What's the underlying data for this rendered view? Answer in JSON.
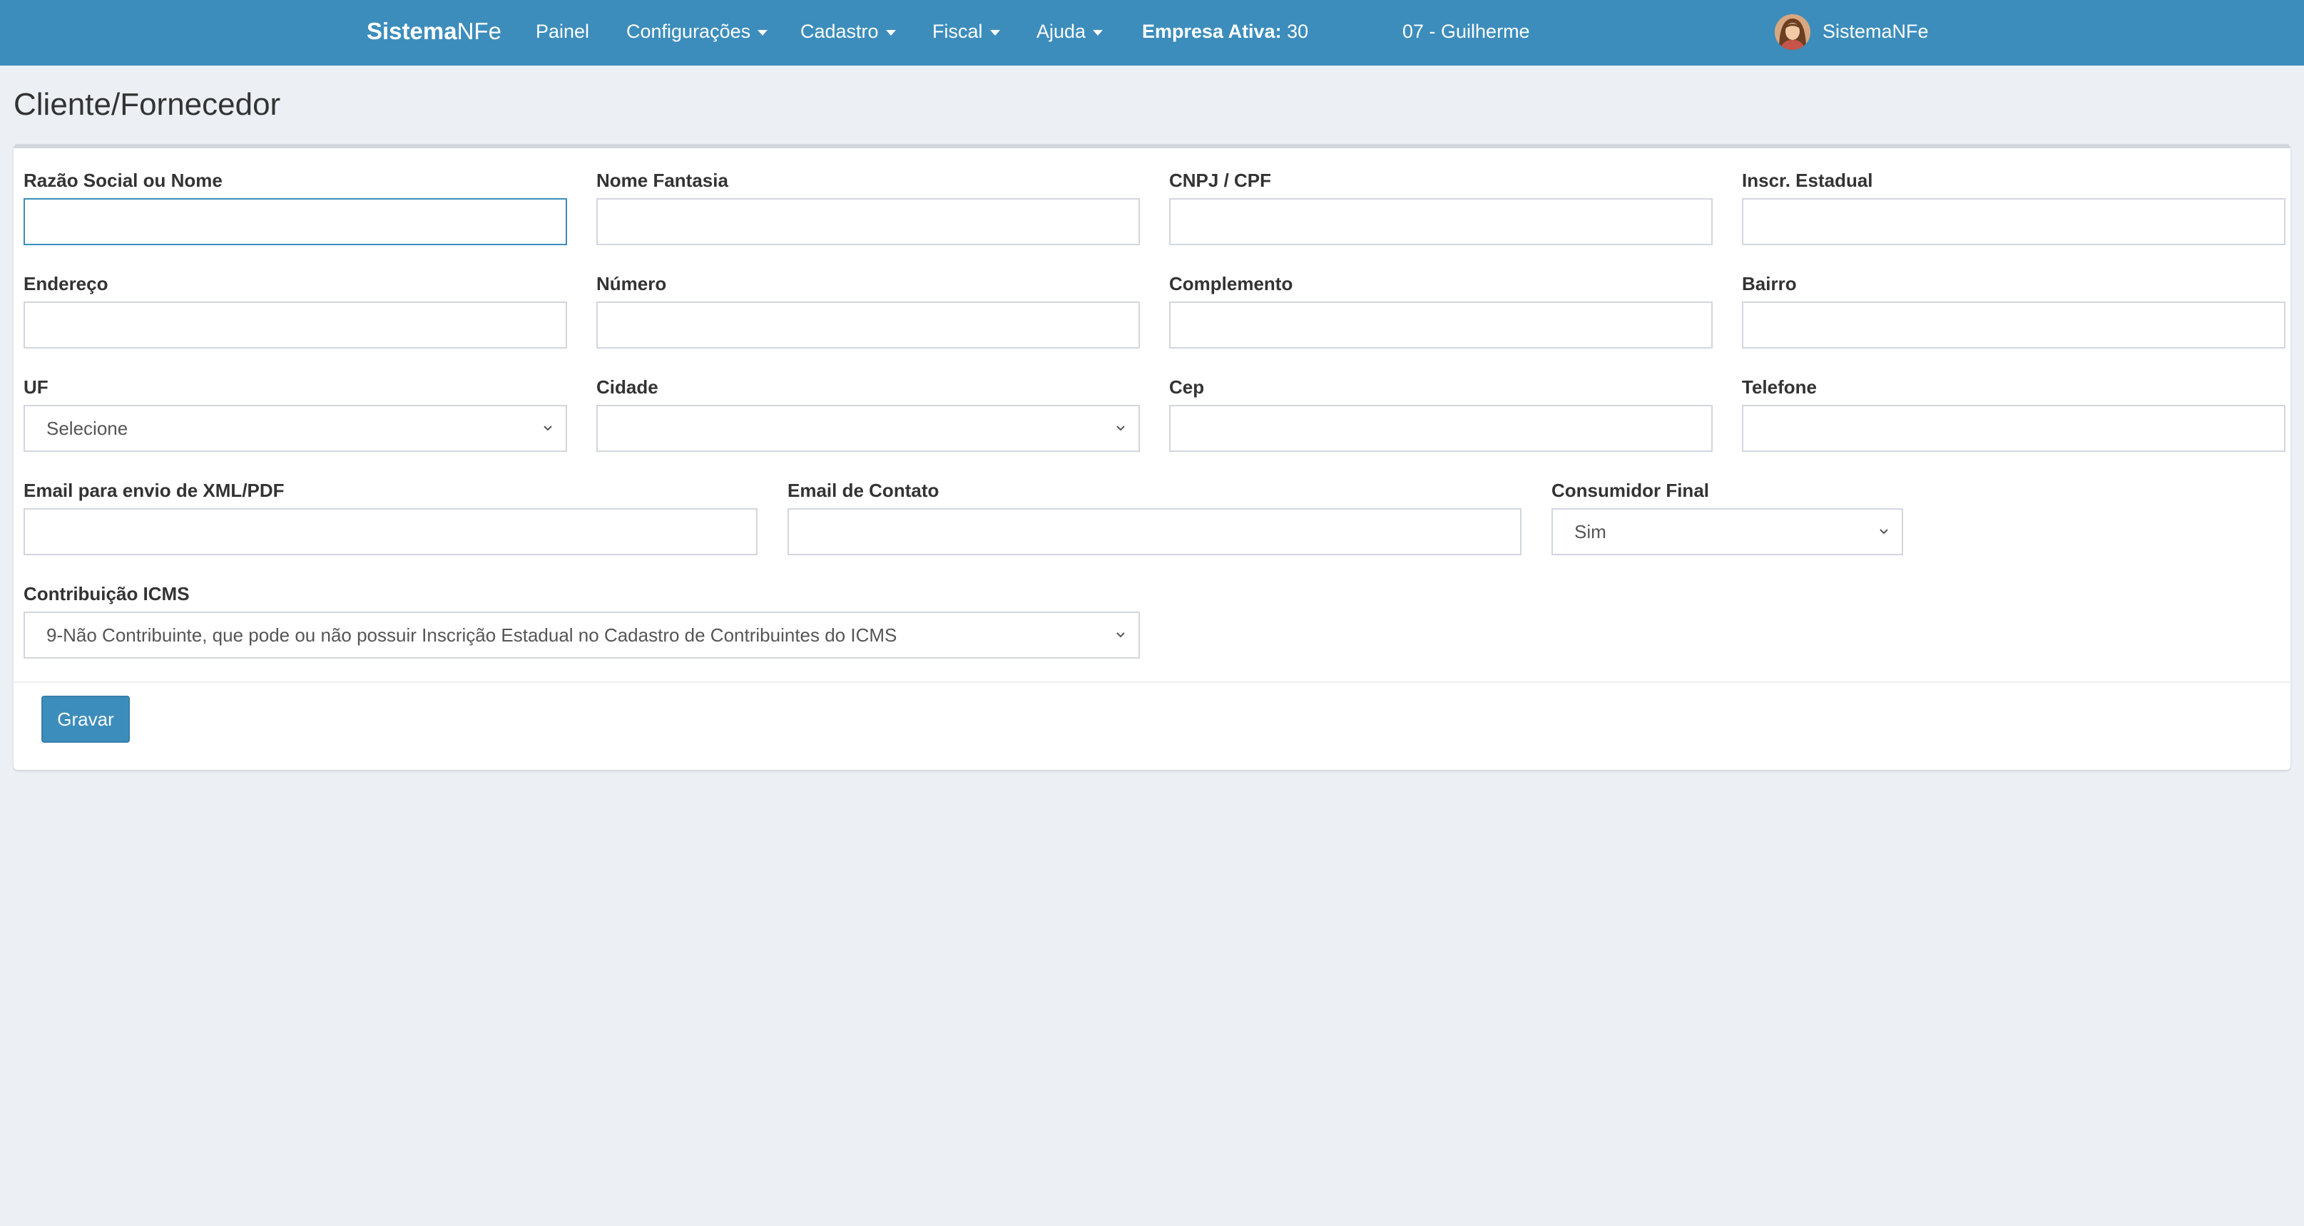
{
  "navbar": {
    "brand_bold": "Sistema",
    "brand_rest": "NFe",
    "items": [
      "Painel",
      "Configurações",
      "Cadastro",
      "Fiscal",
      "Ajuda"
    ],
    "empresa_label": "Empresa Ativa:",
    "empresa_number": "30",
    "empresa_name": "07 - Guilherme",
    "user_name": "SistemaNFe"
  },
  "page": {
    "title": "Cliente/Fornecedor"
  },
  "form": {
    "razao_social": {
      "label": "Razão Social ou Nome",
      "value": ""
    },
    "nome_fantasia": {
      "label": "Nome Fantasia",
      "value": ""
    },
    "cnpj_cpf": {
      "label": "CNPJ / CPF",
      "value": ""
    },
    "inscr_estadual": {
      "label": "Inscr. Estadual",
      "value": ""
    },
    "endereco": {
      "label": "Endereço",
      "value": ""
    },
    "numero": {
      "label": "Número",
      "value": ""
    },
    "complemento": {
      "label": "Complemento",
      "value": ""
    },
    "bairro": {
      "label": "Bairro",
      "value": ""
    },
    "uf": {
      "label": "UF",
      "selected": "Selecione"
    },
    "cidade": {
      "label": "Cidade",
      "selected": ""
    },
    "cep": {
      "label": "Cep",
      "value": ""
    },
    "telefone": {
      "label": "Telefone",
      "value": ""
    },
    "email_xml": {
      "label": "Email para envio de XML/PDF",
      "value": ""
    },
    "email_contato": {
      "label": "Email de Contato",
      "value": ""
    },
    "consumidor_final": {
      "label": "Consumidor Final",
      "selected": "Sim"
    },
    "contribuicao_icms": {
      "label": "Contribuição ICMS",
      "selected": "9-Não Contribuinte, que pode ou não possuir Inscrição Estadual no Cadastro de Contribuintes do ICMS"
    },
    "save_label": "Gravar"
  },
  "colors": {
    "navbar": "#3c8dbc",
    "background": "#ecf0f5",
    "button": "#3c8dbc",
    "box_border": "#d2d6de"
  }
}
